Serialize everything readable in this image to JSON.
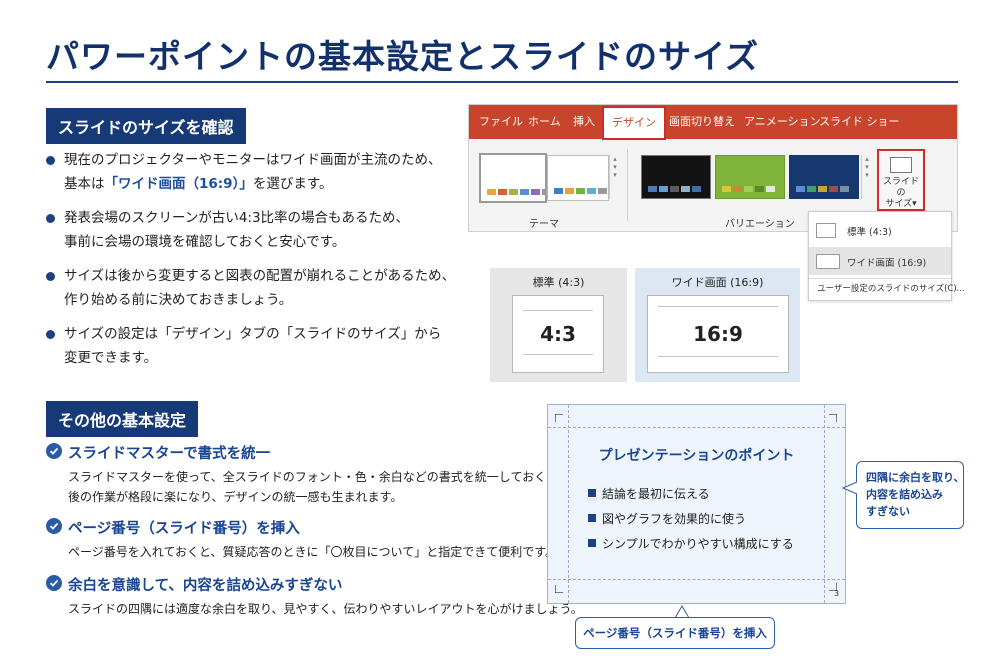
{
  "title": "パワーポイントの基本設定とスライドのサイズ",
  "section1": {
    "heading": "スライドのサイズを確認",
    "bullets": [
      {
        "line1_pre": "現在のプロジェクターやモニターはワイド画面が主流のため、",
        "line2_pre": "基本は",
        "line2_hl": "「ワイド画面（16:9）」",
        "line2_post": "を選びます。"
      },
      {
        "line1": "発表会場のスクリーンが古い4:3比率の場合もあるため、",
        "line2": "事前に会場の環境を確認しておくと安心です。"
      },
      {
        "line1": "サイズは後から変更すると図表の配置が崩れることがあるため、",
        "line2": "作り始める前に決めておきましょう。"
      },
      {
        "line1": "サイズの設定は「デザイン」タブの「スライドのサイズ」から",
        "line2": "変更できます。"
      }
    ]
  },
  "ribbon": {
    "tabs": [
      "ファイル",
      "ホーム",
      "挿入",
      "デザイン",
      "画面切り替え",
      "アニメーション",
      "スライド ショー"
    ],
    "active_tab": "デザイン",
    "theme_group_label": "テーマ",
    "variation_group_label": "バリエーション",
    "slide_size_button": {
      "line1": "スライドの",
      "line2": "サイズ▾"
    },
    "accent_color": "#c8452b"
  },
  "dropdown": {
    "items": [
      "標準 (4:3)",
      "ワイド画面 (16:9)"
    ],
    "custom": "ユーザー設定のスライドのサイズ(C)..."
  },
  "ratios": {
    "standard": {
      "caption": "標準 (4:3)",
      "label": "4:3"
    },
    "wide": {
      "caption": "ワイド画面 (16:9)",
      "label": "16:9"
    }
  },
  "section2": {
    "heading": "その他の基本設定",
    "tips": [
      {
        "title": "スライドマスターで書式を統一",
        "body1": "スライドマスターを使って、全スライドのフォント・色・余白などの書式を統一しておくと、",
        "body2": "後の作業が格段に楽になり、デザインの統一感も生まれます。"
      },
      {
        "title": "ページ番号（スライド番号）を挿入",
        "body1": "ページ番号を入れておくと、質疑応答のときに「〇枚目について」と指定できて便利です。"
      },
      {
        "title": "余白を意識して、内容を詰め込みすぎない",
        "body1": "スライドの四隅には適度な余白を取り、見やすく、伝わりやすいレイアウトを心がけましょう。"
      }
    ]
  },
  "sample_slide": {
    "title": "プレゼンテーションのポイント",
    "items": [
      "結論を最初に伝える",
      "図やグラフを効果的に使う",
      "シンプルでわかりやすい構成にする"
    ],
    "page_number": "3"
  },
  "callouts": {
    "margin": [
      "四隅に余白を取り、",
      "内容を詰め込み",
      "すぎない"
    ],
    "page_number": "ページ番号（スライド番号）を挿入"
  }
}
